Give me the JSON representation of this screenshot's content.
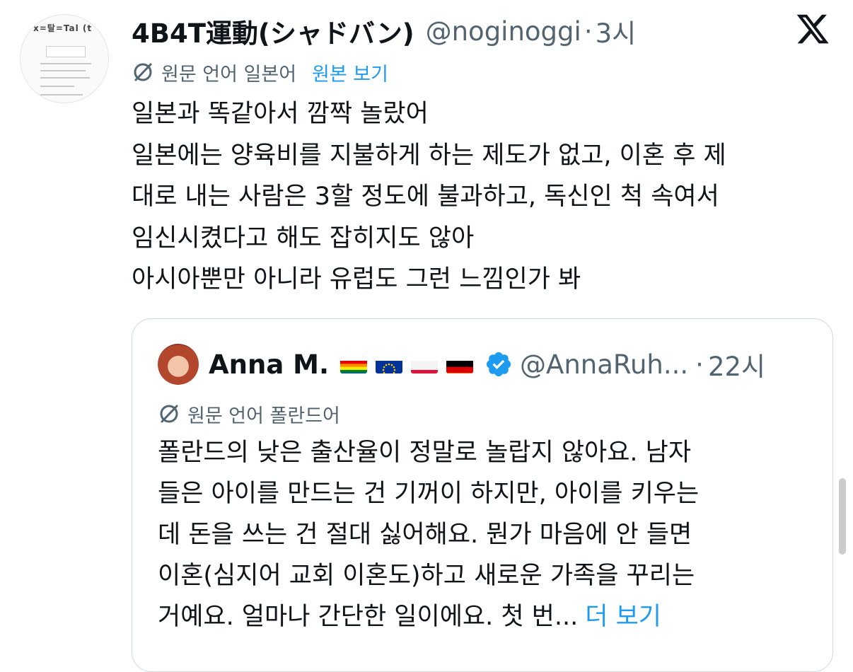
{
  "tweet": {
    "author_name": "4B4T運動(シャドバン)",
    "handle": "@noginoggi",
    "separator": "·",
    "time": "3시",
    "avatar_text": "x=탈=Tal (t",
    "translation": {
      "language_label": "원문 언어 일본어",
      "show_original": "원본 보기"
    },
    "lines": [
      "일본과 똑같아서 깜짝 놀랐어",
      "일본에는 양육비를 지불하게 하는 제도가 없고, 이혼 후 제",
      "대로 내는 사람은 3할 정도에 불과하고, 독신인 척 속여서",
      "임신시켰다고 해도 잡히지도 않아",
      "아시아뿐만 아니라 유럽도 그런 느낌인가 봐"
    ]
  },
  "quoted": {
    "author_name": "Anna M.",
    "handle": "@AnnaRuh...",
    "separator": "·",
    "time": "22시",
    "flags": [
      "rainbow-flag-icon",
      "eu-flag-icon",
      "poland-flag-icon",
      "germany-flag-icon"
    ],
    "translation": {
      "language_label": "원문 언어 폴란드어"
    },
    "lines": [
      "폴란드의 낮은 출산율이 정말로 놀랍지 않아요. 남자",
      "들은 아이를 만드는 건 기꺼이 하지만, 아이를 키우는",
      "데 돈을 쓰는 건 절대 싫어해요. 뭔가 마음에 안 들면",
      "이혼(심지어 교회 이혼도)하고 새로운 가족을 꾸리는",
      "거예요. 얼마나 간단한 일이에요. 첫 번..."
    ],
    "show_more": "더 보기"
  },
  "colors": {
    "text": "#0f1419",
    "secondary": "#536471",
    "link": "#1d9bf0",
    "border": "#cfd9de"
  },
  "icons": {
    "platform_logo": "x-logo-icon",
    "translate": "translate-icon",
    "verified": "verified-badge-icon"
  }
}
